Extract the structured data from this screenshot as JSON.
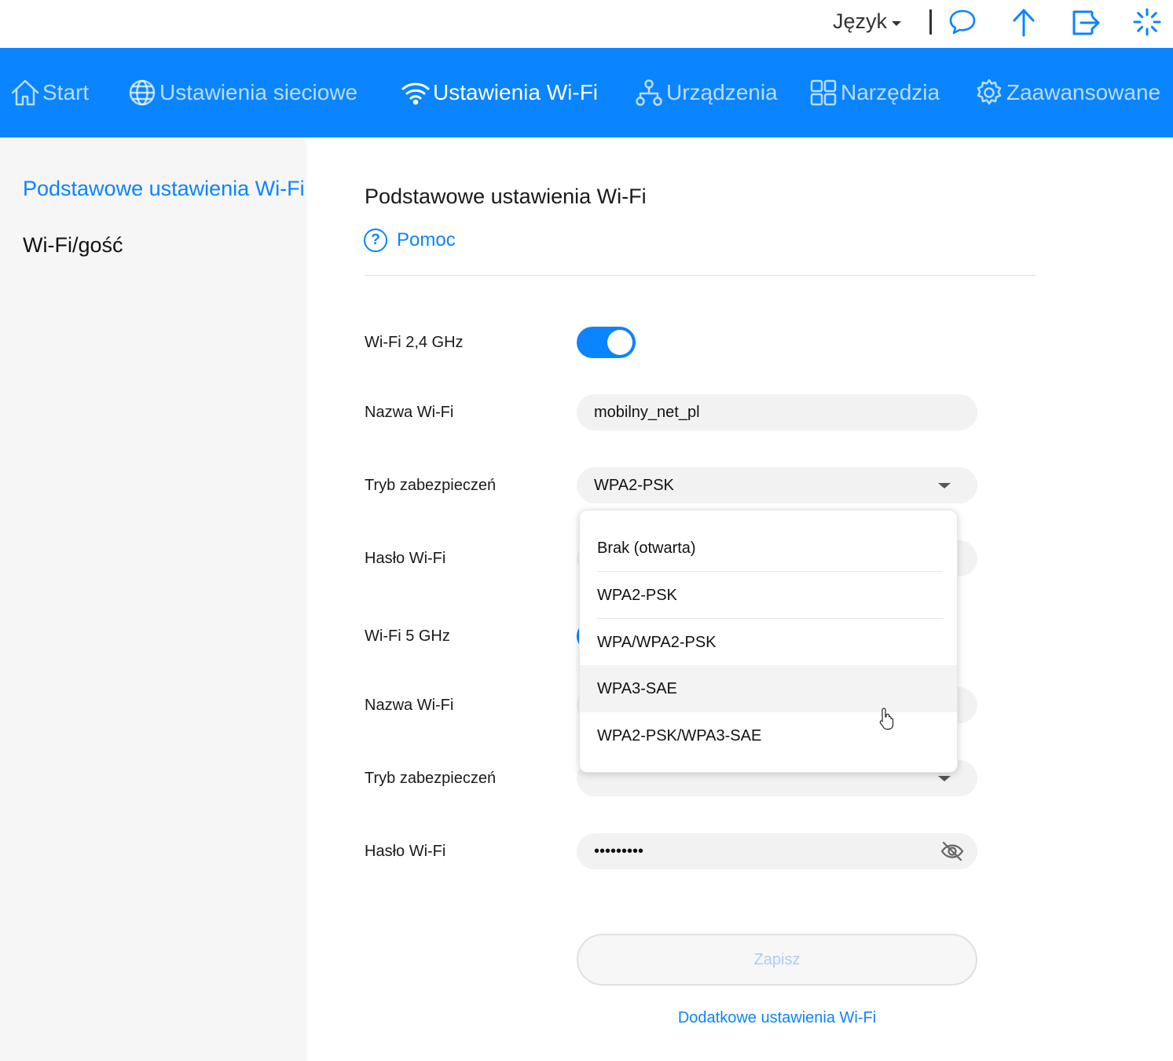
{
  "topbar": {
    "language_label": "Język",
    "icons": [
      "chat-icon",
      "upload-icon",
      "logout-icon",
      "loading-icon"
    ]
  },
  "nav": {
    "items": [
      {
        "label": "Start",
        "icon": "home-icon",
        "active": false
      },
      {
        "label": "Ustawienia sieciowe",
        "icon": "globe-icon",
        "active": false
      },
      {
        "label": "Ustawienia Wi-Fi",
        "icon": "wifi-icon",
        "active": true
      },
      {
        "label": "Urządzenia",
        "icon": "devices-icon",
        "active": false
      },
      {
        "label": "Narzędzia",
        "icon": "apps-icon",
        "active": false
      },
      {
        "label": "Zaawansowane",
        "icon": "gear-icon",
        "active": false
      }
    ]
  },
  "sidebar": {
    "items": [
      {
        "label": "Podstawowe ustawienia Wi-Fi",
        "active": true
      },
      {
        "label": "Wi-Fi/gość",
        "active": false
      }
    ]
  },
  "main": {
    "title": "Podstawowe ustawienia Wi-Fi",
    "help_label": "Pomoc",
    "help_icon": "?",
    "wifi24": {
      "toggle_label": "Wi-Fi 2,4 GHz",
      "enabled": true,
      "name_label": "Nazwa Wi-Fi",
      "name_value": "mobilny_net_pl",
      "security_label": "Tryb zabezpieczeń",
      "security_value": "WPA2-PSK",
      "password_label": "Hasło Wi-Fi"
    },
    "wifi5": {
      "toggle_label": "Wi-Fi 5 GHz",
      "name_label": "Nazwa Wi-Fi",
      "security_label": "Tryb zabezpieczeń",
      "password_label": "Hasło Wi-Fi",
      "password_value": "•••••••••"
    },
    "save_label": "Zapisz",
    "extra_link": "Dodatkowe ustawienia Wi-Fi"
  },
  "dropdown": {
    "options": [
      "Brak (otwarta)",
      "WPA2-PSK",
      "WPA/WPA2-PSK",
      "WPA3-SAE",
      "WPA2-PSK/WPA3-SAE"
    ],
    "hovered": "WPA3-SAE"
  },
  "colors": {
    "accent": "#0a84ff",
    "sidebar_bg": "#f6f6f6",
    "field_bg": "#f2f2f2"
  }
}
